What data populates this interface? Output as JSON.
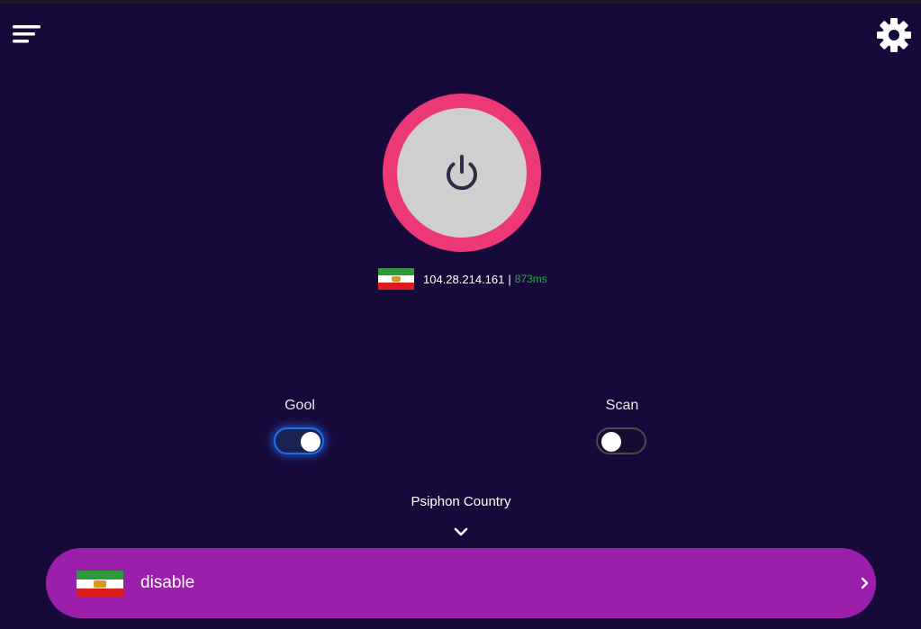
{
  "header": {
    "menu_icon": "menu-icon",
    "settings_icon": "gear-icon"
  },
  "connect": {
    "icon": "power-icon",
    "outer_color": "#ec3877",
    "inner_color": "#cfcfcf"
  },
  "server": {
    "flag_icon": "iran-lion-sun-flag-icon",
    "ip": "104.28.214.161",
    "separator": "|",
    "ping": "873ms",
    "ping_color": "#2fa34a"
  },
  "toggles": [
    {
      "label": "Gool",
      "on": true
    },
    {
      "label": "Scan",
      "on": false
    }
  ],
  "psiphon": {
    "label": "Psiphon Country",
    "expand_icon": "chevron-down-icon",
    "selected_value": "disable",
    "flag_icon": "iran-lion-sun-flag-icon",
    "arrow_icon": "chevron-right-icon",
    "bar_color": "#9c1fab"
  },
  "colors": {
    "background": "#170a3b",
    "accent_blue": "#1e6ff0"
  }
}
